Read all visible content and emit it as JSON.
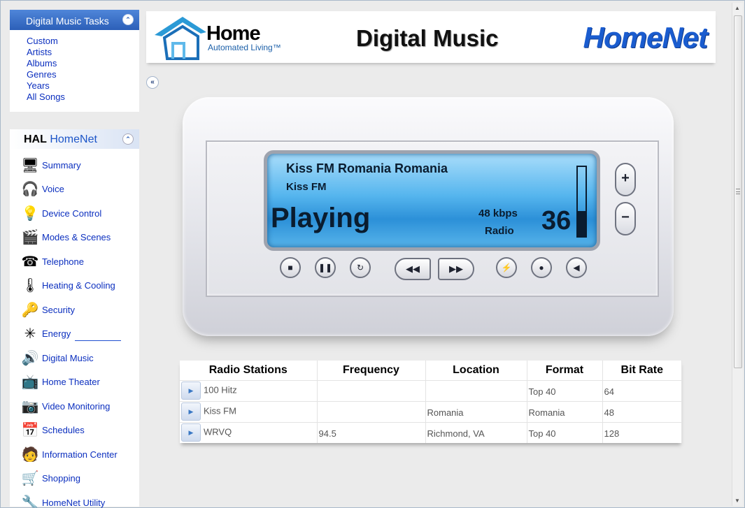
{
  "tasks": {
    "title": "Digital Music Tasks",
    "links": [
      "Custom",
      "Artists",
      "Albums",
      "Genres",
      "Years",
      "All Songs"
    ]
  },
  "hal": {
    "brand_bold": "HAL",
    "brand_name": "HomeNet",
    "items": [
      {
        "label": "Summary",
        "icon": "summary-icon"
      },
      {
        "label": "Voice",
        "icon": "voice-icon"
      },
      {
        "label": "Device Control",
        "icon": "device-control-icon"
      },
      {
        "label": "Modes & Scenes",
        "icon": "modes-scenes-icon"
      },
      {
        "label": "Telephone",
        "icon": "telephone-icon"
      },
      {
        "label": "Heating & Cooling",
        "icon": "thermometer-icon"
      },
      {
        "label": "Security",
        "icon": "keys-icon"
      },
      {
        "label": "Energy",
        "icon": "energy-icon"
      },
      {
        "label": "Digital Music",
        "icon": "speaker-icon"
      },
      {
        "label": "Home Theater",
        "icon": "home-theater-icon"
      },
      {
        "label": "Video Monitoring",
        "icon": "camera-icon"
      },
      {
        "label": "Schedules",
        "icon": "calendar-icon"
      },
      {
        "label": "Information Center",
        "icon": "info-center-icon"
      },
      {
        "label": "Shopping",
        "icon": "cart-icon"
      },
      {
        "label": "HomeNet Utility",
        "icon": "utility-icon"
      }
    ]
  },
  "header": {
    "logo_home": "Home",
    "logo_tagline": "Automated Living™",
    "title": "Digital Music",
    "brand": "HomeNet"
  },
  "player": {
    "station": "Kiss FM Romania Romania",
    "station_sub": "Kiss FM",
    "status": "Playing",
    "bitrate": "48 kbps",
    "source": "Radio",
    "volume": "36",
    "volume_level": 0.36,
    "vol_up": "+",
    "vol_down": "−"
  },
  "stations": {
    "headers": [
      "Radio Stations",
      "Frequency",
      "Location",
      "Format",
      "Bit Rate"
    ],
    "rows": [
      {
        "name": "100 Hitz",
        "frequency": "",
        "location": "",
        "format": "Top 40",
        "bitrate": "64"
      },
      {
        "name": "Kiss FM",
        "frequency": "",
        "location": "Romania",
        "format": "Romania",
        "bitrate": "48"
      },
      {
        "name": "WRVQ",
        "frequency": "94.5",
        "location": "Richmond, VA",
        "format": "Top 40",
        "bitrate": "128"
      }
    ]
  }
}
